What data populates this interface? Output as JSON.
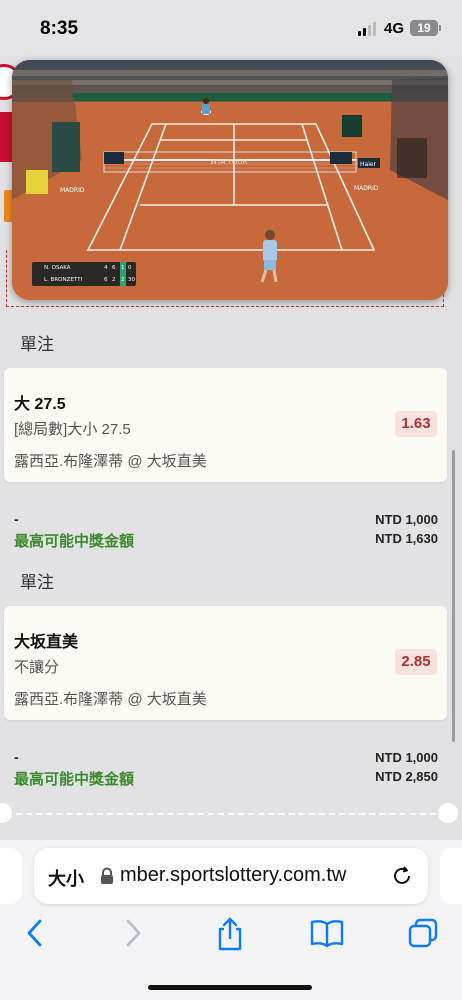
{
  "status_bar": {
    "time": "8:35",
    "network": "4G",
    "battery": "19"
  },
  "video": {
    "scoreboard": {
      "players": [
        {
          "name": "N. OSAKA",
          "set1": "4",
          "set2": "6",
          "set3": "1",
          "points": "0"
        },
        {
          "name": "L. BRONZETTI",
          "set1": "6",
          "set2": "2",
          "set3": "2",
          "points": "30"
        }
      ]
    },
    "court_text": {
      "net_brand": "WTA TOUR",
      "venue_left": "MADRID",
      "venue_right": "MADRID",
      "sponsor": "Haier"
    }
  },
  "bets": [
    {
      "section_title": "單注",
      "selection": "大 27.5",
      "market": "[總局數]大小 27.5",
      "match": "露西亞.布隆澤蒂 @ 大坂直美",
      "odds": "1.63",
      "stake_dash": "-",
      "stake": "NTD 1,000",
      "payout_label": "最高可能中獎金額",
      "payout": "NTD 1,630"
    },
    {
      "section_title": "單注",
      "selection": "大坂直美",
      "market": "不讓分",
      "match": "露西亞.布隆澤蒂 @ 大坂直美",
      "odds": "2.85",
      "stake_dash": "-",
      "stake": "NTD 1,000",
      "payout_label": "最高可能中獎金額",
      "payout": "NTD 2,850"
    }
  ],
  "browser": {
    "text_size_label": "大小",
    "url": "mber.sportslottery.com.tw"
  },
  "icons": [
    "back-icon",
    "forward-icon",
    "share-icon",
    "bookmarks-icon",
    "tabs-icon",
    "lock-icon",
    "reload-icon"
  ],
  "colors": {
    "odds_text": "#b03030",
    "payout_green": "#3c8a2e",
    "ios_blue": "#0a7aff",
    "clay": "#c66a3d"
  }
}
